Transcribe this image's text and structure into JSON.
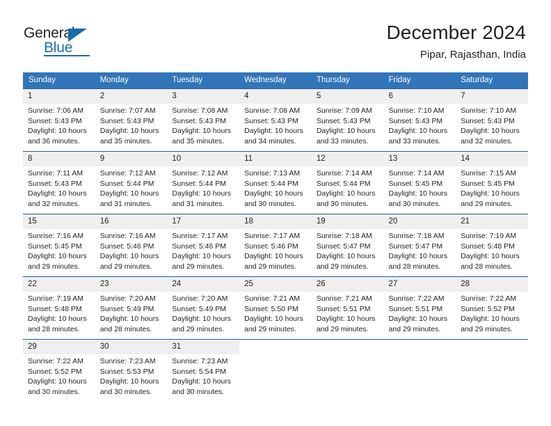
{
  "logo": {
    "word_top": "General",
    "word_bottom": "Blue",
    "accent_color": "#1a6cb0"
  },
  "header": {
    "title": "December 2024",
    "subtitle": "Pipar, Rajasthan, India"
  },
  "calendar": {
    "header_bg": "#3275b8",
    "daynum_bg": "#efefef",
    "weekdays": [
      "Sunday",
      "Monday",
      "Tuesday",
      "Wednesday",
      "Thursday",
      "Friday",
      "Saturday"
    ],
    "weeks": [
      [
        {
          "day": "1",
          "sunrise": "Sunrise: 7:06 AM",
          "sunset": "Sunset: 5:43 PM",
          "daylight": "Daylight: 10 hours and 36 minutes."
        },
        {
          "day": "2",
          "sunrise": "Sunrise: 7:07 AM",
          "sunset": "Sunset: 5:43 PM",
          "daylight": "Daylight: 10 hours and 35 minutes."
        },
        {
          "day": "3",
          "sunrise": "Sunrise: 7:08 AM",
          "sunset": "Sunset: 5:43 PM",
          "daylight": "Daylight: 10 hours and 35 minutes."
        },
        {
          "day": "4",
          "sunrise": "Sunrise: 7:08 AM",
          "sunset": "Sunset: 5:43 PM",
          "daylight": "Daylight: 10 hours and 34 minutes."
        },
        {
          "day": "5",
          "sunrise": "Sunrise: 7:09 AM",
          "sunset": "Sunset: 5:43 PM",
          "daylight": "Daylight: 10 hours and 33 minutes."
        },
        {
          "day": "6",
          "sunrise": "Sunrise: 7:10 AM",
          "sunset": "Sunset: 5:43 PM",
          "daylight": "Daylight: 10 hours and 33 minutes."
        },
        {
          "day": "7",
          "sunrise": "Sunrise: 7:10 AM",
          "sunset": "Sunset: 5:43 PM",
          "daylight": "Daylight: 10 hours and 32 minutes."
        }
      ],
      [
        {
          "day": "8",
          "sunrise": "Sunrise: 7:11 AM",
          "sunset": "Sunset: 5:43 PM",
          "daylight": "Daylight: 10 hours and 32 minutes."
        },
        {
          "day": "9",
          "sunrise": "Sunrise: 7:12 AM",
          "sunset": "Sunset: 5:44 PM",
          "daylight": "Daylight: 10 hours and 31 minutes."
        },
        {
          "day": "10",
          "sunrise": "Sunrise: 7:12 AM",
          "sunset": "Sunset: 5:44 PM",
          "daylight": "Daylight: 10 hours and 31 minutes."
        },
        {
          "day": "11",
          "sunrise": "Sunrise: 7:13 AM",
          "sunset": "Sunset: 5:44 PM",
          "daylight": "Daylight: 10 hours and 30 minutes."
        },
        {
          "day": "12",
          "sunrise": "Sunrise: 7:14 AM",
          "sunset": "Sunset: 5:44 PM",
          "daylight": "Daylight: 10 hours and 30 minutes."
        },
        {
          "day": "13",
          "sunrise": "Sunrise: 7:14 AM",
          "sunset": "Sunset: 5:45 PM",
          "daylight": "Daylight: 10 hours and 30 minutes."
        },
        {
          "day": "14",
          "sunrise": "Sunrise: 7:15 AM",
          "sunset": "Sunset: 5:45 PM",
          "daylight": "Daylight: 10 hours and 29 minutes."
        }
      ],
      [
        {
          "day": "15",
          "sunrise": "Sunrise: 7:16 AM",
          "sunset": "Sunset: 5:45 PM",
          "daylight": "Daylight: 10 hours and 29 minutes."
        },
        {
          "day": "16",
          "sunrise": "Sunrise: 7:16 AM",
          "sunset": "Sunset: 5:46 PM",
          "daylight": "Daylight: 10 hours and 29 minutes."
        },
        {
          "day": "17",
          "sunrise": "Sunrise: 7:17 AM",
          "sunset": "Sunset: 5:46 PM",
          "daylight": "Daylight: 10 hours and 29 minutes."
        },
        {
          "day": "18",
          "sunrise": "Sunrise: 7:17 AM",
          "sunset": "Sunset: 5:46 PM",
          "daylight": "Daylight: 10 hours and 29 minutes."
        },
        {
          "day": "19",
          "sunrise": "Sunrise: 7:18 AM",
          "sunset": "Sunset: 5:47 PM",
          "daylight": "Daylight: 10 hours and 29 minutes."
        },
        {
          "day": "20",
          "sunrise": "Sunrise: 7:18 AM",
          "sunset": "Sunset: 5:47 PM",
          "daylight": "Daylight: 10 hours and 28 minutes."
        },
        {
          "day": "21",
          "sunrise": "Sunrise: 7:19 AM",
          "sunset": "Sunset: 5:48 PM",
          "daylight": "Daylight: 10 hours and 28 minutes."
        }
      ],
      [
        {
          "day": "22",
          "sunrise": "Sunrise: 7:19 AM",
          "sunset": "Sunset: 5:48 PM",
          "daylight": "Daylight: 10 hours and 28 minutes."
        },
        {
          "day": "23",
          "sunrise": "Sunrise: 7:20 AM",
          "sunset": "Sunset: 5:49 PM",
          "daylight": "Daylight: 10 hours and 28 minutes."
        },
        {
          "day": "24",
          "sunrise": "Sunrise: 7:20 AM",
          "sunset": "Sunset: 5:49 PM",
          "daylight": "Daylight: 10 hours and 29 minutes."
        },
        {
          "day": "25",
          "sunrise": "Sunrise: 7:21 AM",
          "sunset": "Sunset: 5:50 PM",
          "daylight": "Daylight: 10 hours and 29 minutes."
        },
        {
          "day": "26",
          "sunrise": "Sunrise: 7:21 AM",
          "sunset": "Sunset: 5:51 PM",
          "daylight": "Daylight: 10 hours and 29 minutes."
        },
        {
          "day": "27",
          "sunrise": "Sunrise: 7:22 AM",
          "sunset": "Sunset: 5:51 PM",
          "daylight": "Daylight: 10 hours and 29 minutes."
        },
        {
          "day": "28",
          "sunrise": "Sunrise: 7:22 AM",
          "sunset": "Sunset: 5:52 PM",
          "daylight": "Daylight: 10 hours and 29 minutes."
        }
      ],
      [
        {
          "day": "29",
          "sunrise": "Sunrise: 7:22 AM",
          "sunset": "Sunset: 5:52 PM",
          "daylight": "Daylight: 10 hours and 30 minutes."
        },
        {
          "day": "30",
          "sunrise": "Sunrise: 7:23 AM",
          "sunset": "Sunset: 5:53 PM",
          "daylight": "Daylight: 10 hours and 30 minutes."
        },
        {
          "day": "31",
          "sunrise": "Sunrise: 7:23 AM",
          "sunset": "Sunset: 5:54 PM",
          "daylight": "Daylight: 10 hours and 30 minutes."
        },
        {
          "day": "",
          "sunrise": "",
          "sunset": "",
          "daylight": ""
        },
        {
          "day": "",
          "sunrise": "",
          "sunset": "",
          "daylight": ""
        },
        {
          "day": "",
          "sunrise": "",
          "sunset": "",
          "daylight": ""
        },
        {
          "day": "",
          "sunrise": "",
          "sunset": "",
          "daylight": ""
        }
      ]
    ]
  }
}
